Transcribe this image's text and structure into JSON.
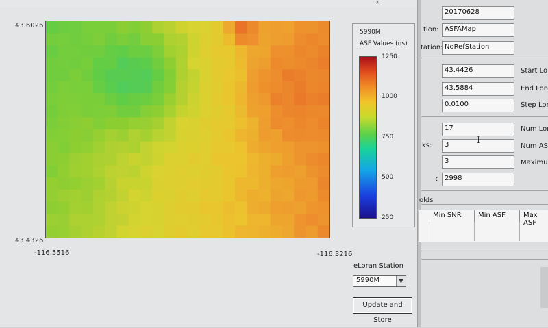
{
  "window": {
    "close_glyph": "✕"
  },
  "map": {
    "lat_top": "43.6026",
    "lat_bottom": "43.4326",
    "lon_left": "-116.5516",
    "lon_right": "-116.3216",
    "grid_rows": 18,
    "grid_cols": 24,
    "colors": {
      "green": "#6fcf3c",
      "teal": "#2fc98d",
      "yellow": "#e6d232",
      "orange": "#ec8f2f",
      "red": "#d9371e"
    }
  },
  "legend": {
    "station": "5990M",
    "title": "ASF Values (ns)",
    "ticks": [
      "1250",
      "1000",
      "750",
      "500",
      "250"
    ]
  },
  "station_selector": {
    "label": "eLoran Station",
    "selected": "5990M"
  },
  "update_button": "Update and Store",
  "params": {
    "date": "20170628",
    "map_label": "tion:",
    "map_value": "ASFAMap",
    "ref_label": "tation:",
    "ref_value": "NoRefStation",
    "start_lon_value": "43.4426",
    "start_lon_label": "Start Lon:",
    "end_lon_value": "43.5884",
    "end_lon_label": "End Lon:",
    "step_lon_value": "0.0100",
    "step_lon_label": "Step Lon:",
    "num_lon_value": "17",
    "num_lon_label": "Num Lon:",
    "blocks_label": "ks:",
    "blocks_value": "3",
    "num_asf_label": "Num ASF",
    "maximum_value": "3",
    "maximum_label": "Maximum",
    "last_label": ":",
    "last_value": "2998",
    "section_label": "olds"
  },
  "table": {
    "headers": [
      "Min SNR",
      "Min ASF",
      "Max ASF"
    ]
  }
}
